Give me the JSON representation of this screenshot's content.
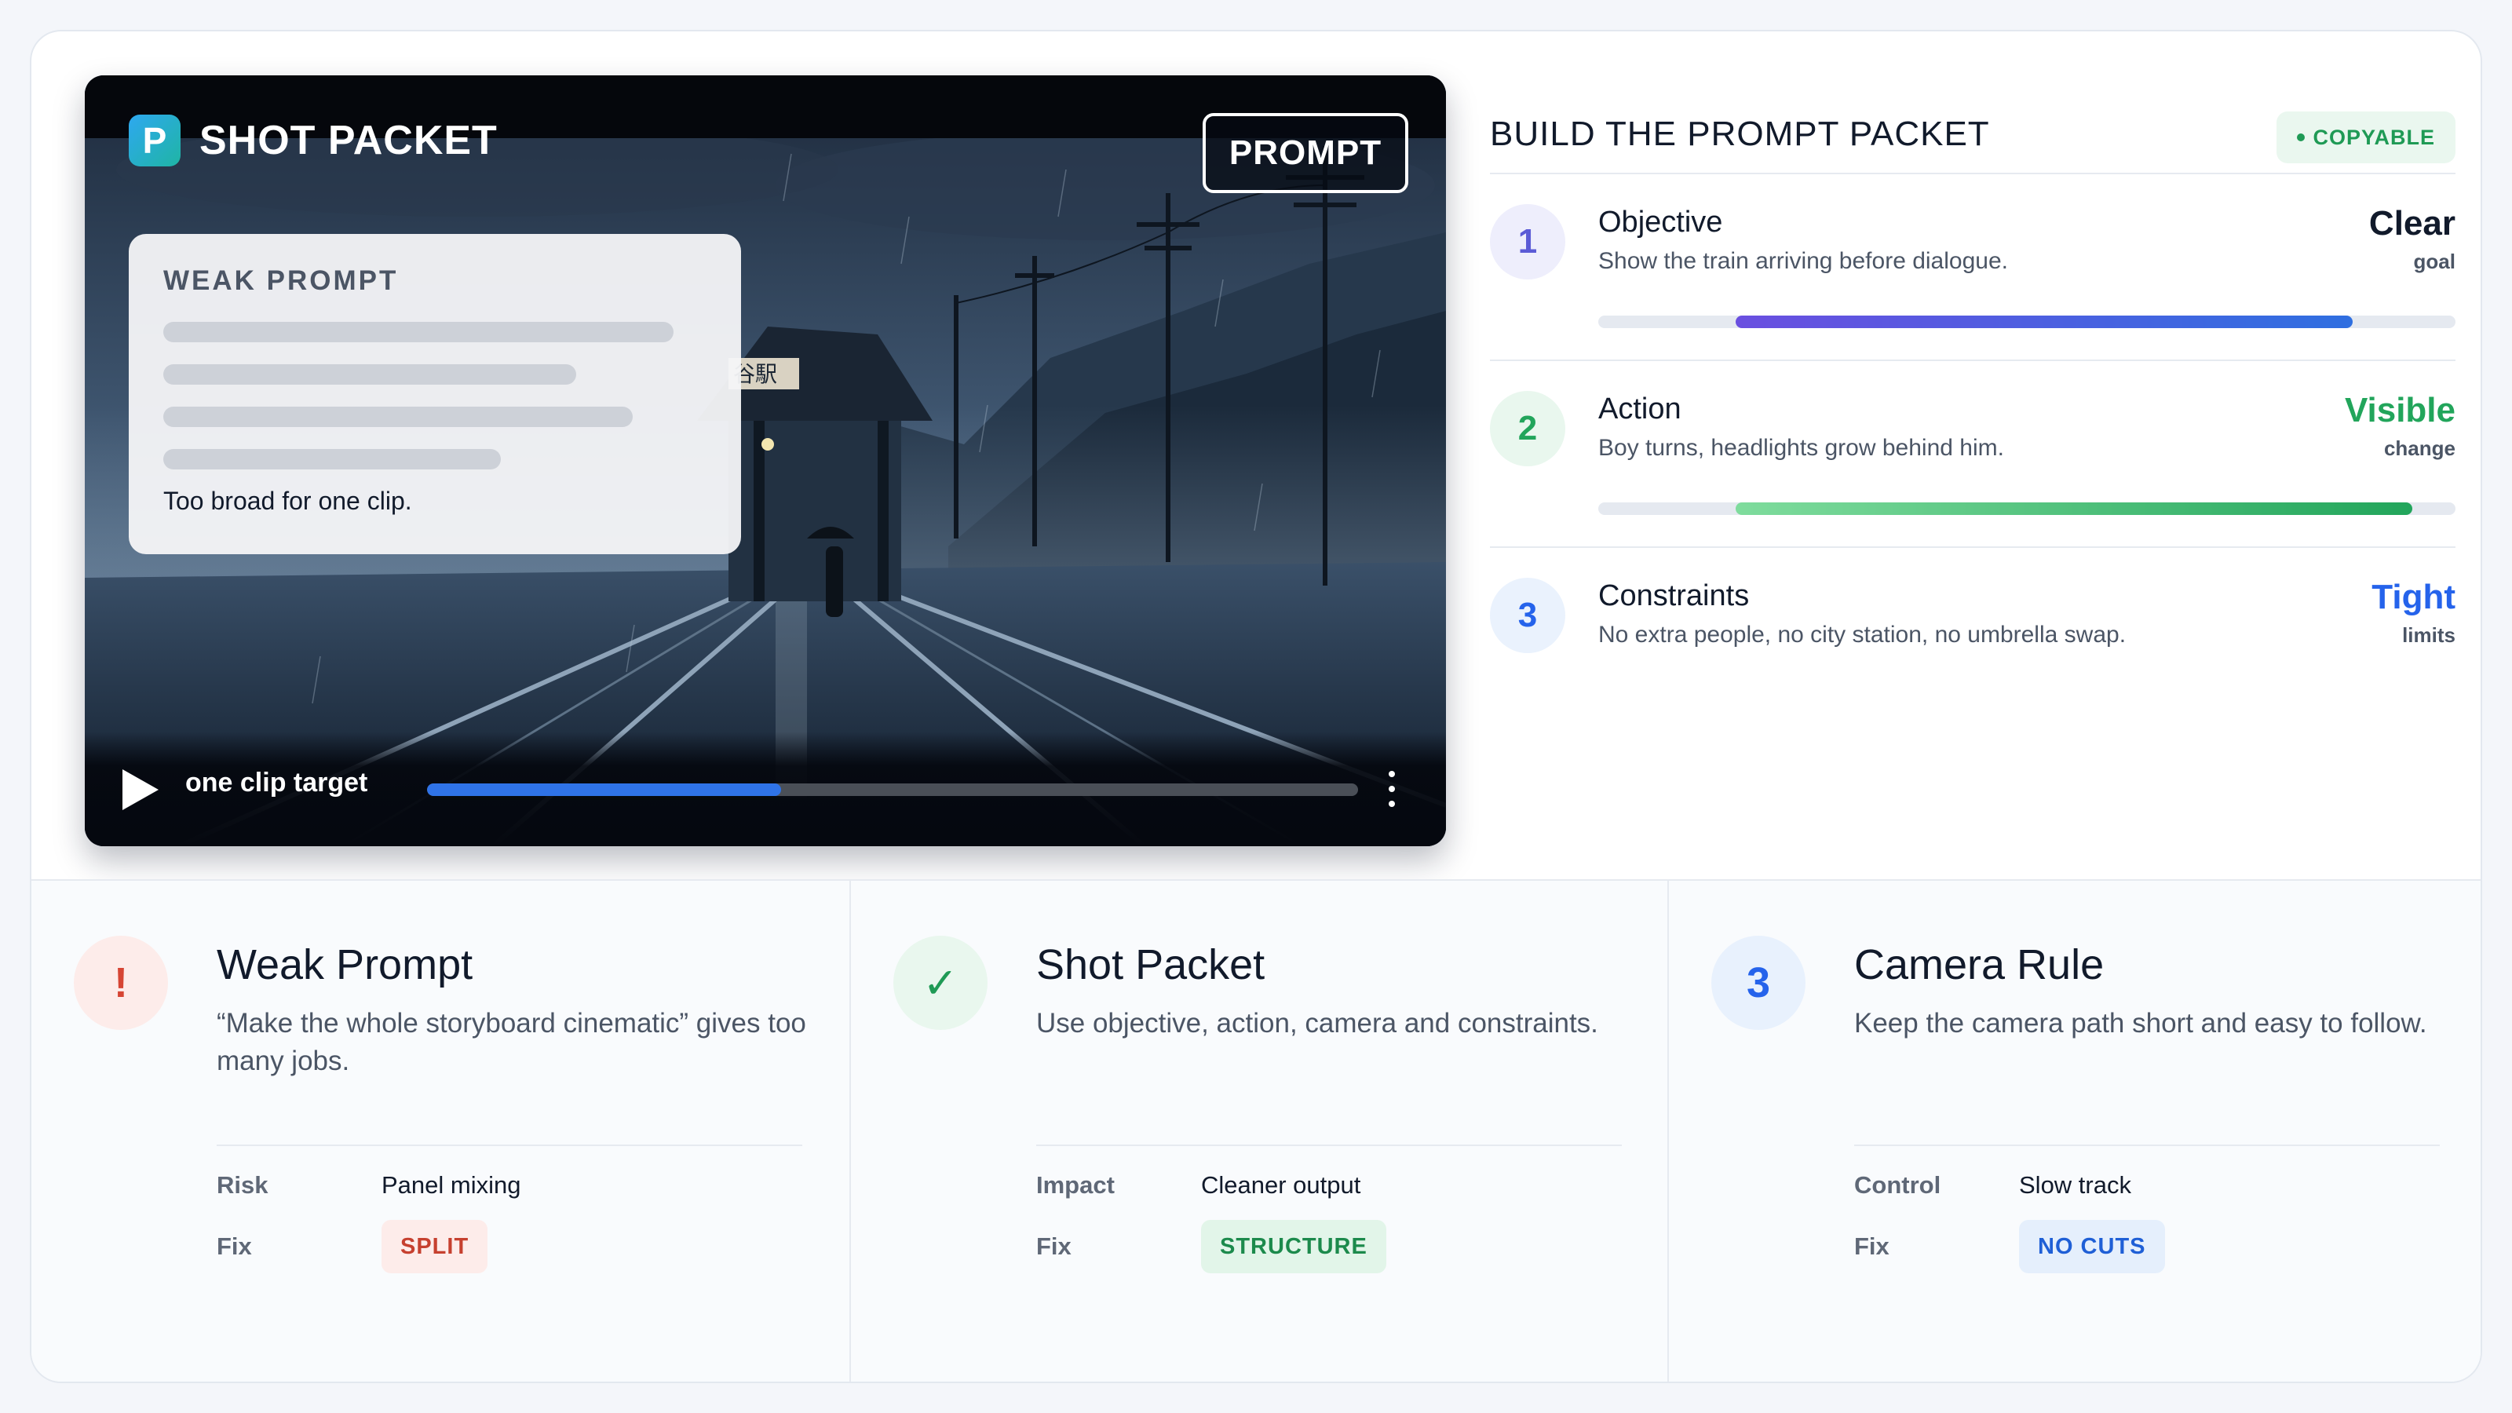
{
  "video": {
    "brand_letter": "P",
    "brand_title": "SHOT PACKET",
    "badge": "PROMPT",
    "weak_card": {
      "title": "WEAK PROMPT",
      "note": "Too broad for one clip."
    },
    "station_sign": "谷駅",
    "controls": {
      "label": "one clip target",
      "progress": 0.38
    }
  },
  "packet": {
    "title": "BUILD THE PROMPT PACKET",
    "badge": "COPYABLE",
    "steps": [
      {
        "num": "1",
        "title": "Objective",
        "desc": "Show the train arriving before dialogue.",
        "value": "Clear",
        "unit": "goal",
        "bar_start": 0.16,
        "bar_end": 0.88,
        "color": "#5b5bd6"
      },
      {
        "num": "2",
        "title": "Action",
        "desc": "Boy turns, headlights grow behind him.",
        "value": "Visible",
        "unit": "change",
        "bar_start": 0.16,
        "bar_end": 0.95,
        "color": "#22a55b"
      },
      {
        "num": "3",
        "title": "Constraints",
        "desc": "No extra people, no city station, no umbrella swap.",
        "value": "Tight",
        "unit": "limits",
        "color": "#2563eb"
      }
    ]
  },
  "cards": [
    {
      "icon": "!",
      "title": "Weak Prompt",
      "desc": "“Make the whole storyboard cinematic” gives too many jobs.",
      "key1": "Risk",
      "val1": "Panel mixing",
      "key2": "Fix",
      "pill": "SPLIT"
    },
    {
      "icon": "✓",
      "title": "Shot Packet",
      "desc": "Use objective, action, camera and constraints.",
      "key1": "Impact",
      "val1": "Cleaner output",
      "key2": "Fix",
      "pill": "STRUCTURE"
    },
    {
      "icon": "3",
      "title": "Camera Rule",
      "desc": "Keep the camera path short and easy to follow.",
      "key1": "Control",
      "val1": "Slow track",
      "key2": "Fix",
      "pill": "NO CUTS"
    }
  ],
  "colors": {
    "accent_blue": "#2f73e8",
    "success_green": "#1f9a55",
    "danger_red": "#d64534",
    "purple": "#5b5bd6"
  }
}
